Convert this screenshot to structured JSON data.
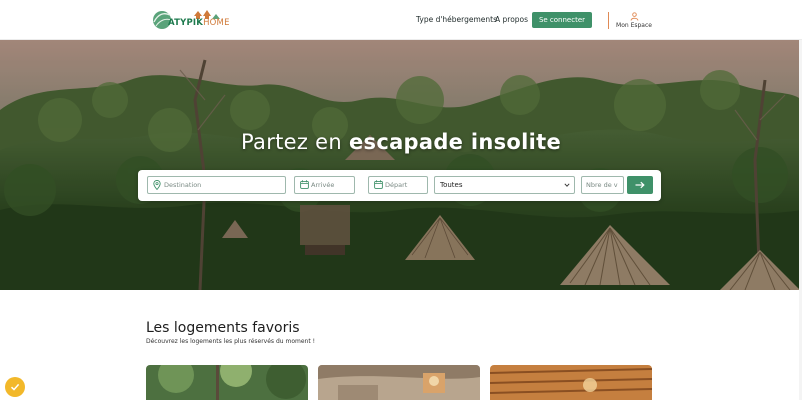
{
  "brand": {
    "name_part1": "ATYPIK",
    "name_part2": "HOME"
  },
  "nav": {
    "type_hebergements": "Type d'hébergements",
    "a_propos": "A propos",
    "connect_label": "Se connecter",
    "mon_espace": "Mon Espace"
  },
  "hero": {
    "title_regular": "Partez en ",
    "title_bold": "escapade insolite"
  },
  "search": {
    "destination_placeholder": "Destination",
    "arrivee_placeholder": "Arrivée",
    "depart_placeholder": "Départ",
    "type_selected": "Toutes",
    "guests_placeholder": "Nbre de v",
    "submit_icon": "arrow-right-icon"
  },
  "favorites": {
    "title": "Les logements favoris",
    "subtitle": "Découvrez les logements les plus réservés du moment !"
  },
  "colors": {
    "brand_green": "#3f9169",
    "brand_orange": "#e08a55",
    "badge_yellow": "#f2b82a"
  }
}
